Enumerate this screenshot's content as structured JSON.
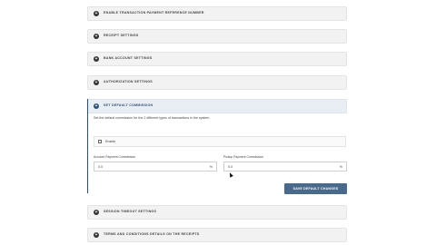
{
  "panels_top": [
    {
      "title": "ENABLE TRANSACTION PAYMENT REFERENCE NUMBER"
    },
    {
      "title": "RECEIPT SETTINGS"
    },
    {
      "title": "BANK ACCOUNT SETTINGS"
    },
    {
      "title": "AUTHORIZATION SETTINGS"
    }
  ],
  "commission": {
    "title": "SET DEFAULT COMMISSION",
    "description": "Set the default commission for the 2 different types of transactions in the system.",
    "enable_label": "Enable",
    "account_label": "Account Payment Commission",
    "account_value": "0.0",
    "pickup_label": "Pickup Payment Commission",
    "pickup_value": "0.0",
    "unit": "%",
    "save_label": "SAVE DEFAULT CHANGES"
  },
  "panels_bottom": [
    {
      "title": "SESSION TIMEOUT SETTINGS"
    },
    {
      "title": "TERMS AND CONDITIONS DETAILS ON THE RECEIPTS"
    }
  ],
  "icons": {
    "toggle": "circle-plus-icon"
  }
}
